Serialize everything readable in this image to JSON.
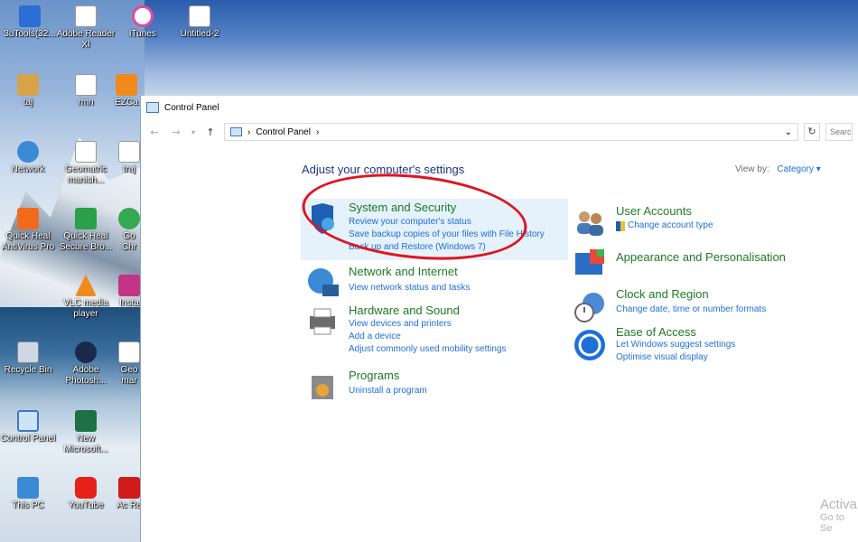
{
  "desktop": {
    "icons": [
      {
        "label": "3uTools(32...",
        "icon": "3utools-icon",
        "color": "#2a6fd6"
      },
      {
        "label": "Adobe Reader XI",
        "icon": "file-icon",
        "color": "#ffffff"
      },
      {
        "label": "iTunes",
        "icon": "itunes-icon",
        "color": "#e14a9a"
      },
      {
        "label": "Untitled-2",
        "icon": "file-icon",
        "color": "#ffffff"
      },
      {
        "label": "taj",
        "icon": "user-folder-icon",
        "color": "#d8a24a"
      },
      {
        "label": "rmn",
        "icon": "file-icon",
        "color": "#ffffff"
      },
      {
        "label": "EZCa",
        "icon": "ezcast-icon",
        "color": "#f08a1c"
      },
      {
        "label": "Network",
        "icon": "network-icon",
        "color": "#3a8ad6"
      },
      {
        "label": "Geomatric manish...",
        "icon": "file-icon",
        "color": "#ffffff"
      },
      {
        "label": "traj",
        "icon": "file-icon",
        "color": "#ffffff"
      },
      {
        "label": "Quick Heal AntiVirus Pro",
        "icon": "quickheal-icon",
        "color": "#f26a1c"
      },
      {
        "label": "Quick Heal Secure Bro...",
        "icon": "quickheal-browser-icon",
        "color": "#2aa04a"
      },
      {
        "label": "Go Chr",
        "icon": "chrome-icon",
        "color": "#34a853"
      },
      {
        "label": "VLC media player",
        "icon": "vlc-icon",
        "color": "#f08a1c"
      },
      {
        "label": "Insta",
        "icon": "instagram-icon",
        "color": "#c13584"
      },
      {
        "label": "Recycle Bin",
        "icon": "recycle-bin-icon",
        "color": "#cfd8e2"
      },
      {
        "label": "Adobe Photosh...",
        "icon": "photoshop-icon",
        "color": "#1b2a4a"
      },
      {
        "label": "Geo mar",
        "icon": "file-icon",
        "color": "#ffffff"
      },
      {
        "label": "Control Panel",
        "icon": "control-panel-icon",
        "color": "#3a78c4"
      },
      {
        "label": "New Microsoft...",
        "icon": "excel-icon",
        "color": "#1e7145"
      },
      {
        "label": "This PC",
        "icon": "this-pc-icon",
        "color": "#3a8ad6"
      },
      {
        "label": "YouTube",
        "icon": "youtube-icon",
        "color": "#e62117"
      },
      {
        "label": "Ac Re",
        "icon": "acrobat-icon",
        "color": "#d11b1b"
      }
    ]
  },
  "window": {
    "title": "Control Panel",
    "address": "Control Panel",
    "search_placeholder": "Search",
    "heading": "Adjust your computer's settings",
    "view_by_label": "View by:",
    "view_by_value": "Category ▾",
    "categories": [
      {
        "title": "System and Security",
        "icon": "shield-icon",
        "links": [
          "Review your computer's status",
          "Save backup copies of your files with File History",
          "Back up and Restore (Windows 7)"
        ]
      },
      {
        "title": "Network and Internet",
        "icon": "globe-network-icon",
        "links": [
          "View network status and tasks"
        ]
      },
      {
        "title": "Hardware and Sound",
        "icon": "printer-icon",
        "links": [
          "View devices and printers",
          "Add a device",
          "Adjust commonly used mobility settings"
        ]
      },
      {
        "title": "Programs",
        "icon": "programs-icon",
        "links": [
          "Uninstall a program"
        ]
      },
      {
        "title": "User Accounts",
        "icon": "users-icon",
        "links": [
          "Change account type"
        ]
      },
      {
        "title": "Appearance and Personalisation",
        "icon": "appearance-icon",
        "links": []
      },
      {
        "title": "Clock and Region",
        "icon": "clock-globe-icon",
        "links": [
          "Change date, time or number formats"
        ]
      },
      {
        "title": "Ease of Access",
        "icon": "ease-of-access-icon",
        "links": [
          "Let Windows suggest settings",
          "Optimise visual display"
        ]
      }
    ]
  },
  "watermark": {
    "line1": "Activa",
    "line2": "Go to Se"
  },
  "colors": {
    "link": "#1e6fd9",
    "category_title": "#1e7a24",
    "heading": "#1e3287",
    "highlight": "#e5f1fb",
    "annotation": "#e0141e"
  }
}
